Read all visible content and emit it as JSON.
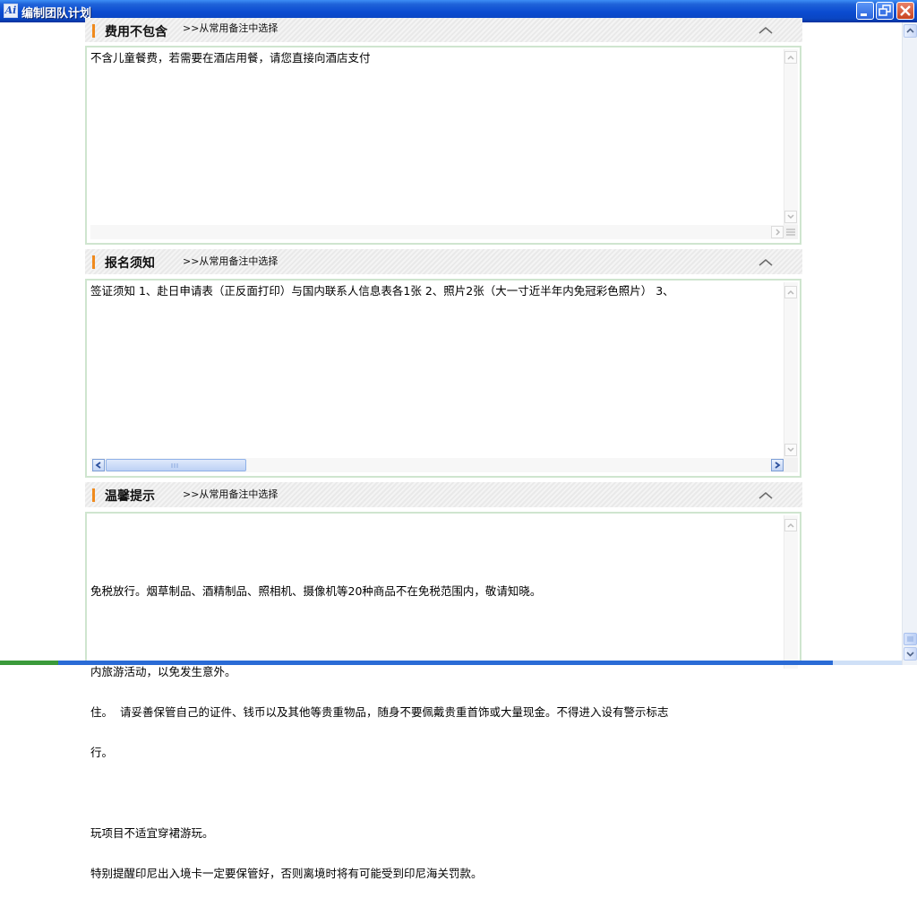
{
  "window": {
    "title": "编制团队计划",
    "app_icon_letters": "Ai",
    "minimize_icon": "minimize-icon",
    "maximize_icon": "restore-icon",
    "close_icon": "close-icon"
  },
  "sections": [
    {
      "title": "费用不包含",
      "pick_label": ">>从常用备注中选择",
      "text": "不含儿童餐费，若需要在酒店用餐，请您直接向酒店支付"
    },
    {
      "title": "报名须知",
      "pick_label": ">>从常用备注中选择",
      "text": "签证须知 1、赴日申请表（正反面打印）与国内联系人信息表各1张 2、照片2张（大一寸近半年内免冠彩色照片） 3、"
    },
    {
      "title": "温馨提示",
      "pick_label": ">>从常用备注中选择",
      "lines": [
        "",
        "免税放行。烟草制品、酒精制品、照相机、摄像机等20种商品不在免税范围内，敬请知晓。",
        "",
        "内旅游活动，以免发生意外。",
        "住。  请妥善保管自己的证件、钱币以及其他等贵重物品，随身不要佩戴贵重首饰或大量现金。不得进入设有警示标志",
        "行。",
        "",
        "玩项目不适宜穿裙游玩。",
        "特别提醒印尼出入境卡一定要保管好，否则离境时将有可能受到印尼海关罚款。"
      ]
    }
  ],
  "colors": {
    "accent_bar": "#f08a1c",
    "textbox_border": "#cfe5cf",
    "titlebar": "#0b4cd1"
  }
}
